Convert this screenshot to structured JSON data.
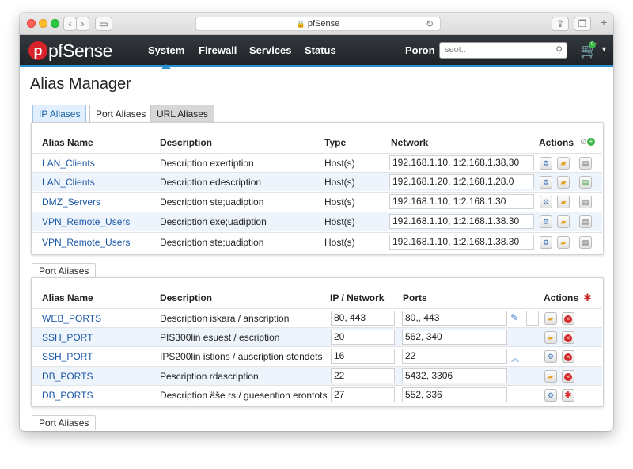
{
  "browser": {
    "url": "pfSense"
  },
  "navbar": {
    "logo_letter": "p",
    "logo_text": "pfSense",
    "items": [
      {
        "label": "System",
        "active": true
      },
      {
        "label": "Firewall"
      },
      {
        "label": "Services"
      },
      {
        "label": "Status"
      },
      {
        "label": "Poron"
      }
    ],
    "search_placeholder": "seot..",
    "cart_badge": "0"
  },
  "page": {
    "title": "Alias Manager"
  },
  "tabs": [
    {
      "label": "IP Aliases",
      "active": true
    },
    {
      "label": "Port Aliases"
    },
    {
      "label": "URL Aliases"
    }
  ],
  "ip_table": {
    "headers": [
      "Alias Name",
      "Description",
      "Type",
      "Network",
      "Actions"
    ],
    "rows": [
      {
        "name": "LAN_Clients",
        "description": "Description exertiption",
        "type": "Host(s)",
        "network": "192.168.1.10, 1:2.168.1.38,30"
      },
      {
        "name": "LAN_Clients",
        "description": "Description edescription",
        "type": "Host(s)",
        "network": "192.168.1.20, 1:2.168.1.28.0"
      },
      {
        "name": "DMZ_Servers",
        "description": "Description ste;uadiption",
        "type": "Host(s)",
        "network": "192.168.1.10, 1:2.168.1.30"
      },
      {
        "name": "VPN_Remote_Users",
        "description": "Description exe;uadiption",
        "type": "Host(s)",
        "network": "192.168.1.10, 1:2.168.1.38.30"
      },
      {
        "name": "VPN_Remote_Users",
        "description": "Description ste;uadiption",
        "type": "Host(s)",
        "network": "192.168.1.10, 1:2.168.1.38.30"
      }
    ]
  },
  "port_section_label": "Port Aliases",
  "port_table": {
    "headers": [
      "Alias Name",
      "Description",
      "IP / Network",
      "Ports",
      "Actions"
    ],
    "rows": [
      {
        "name": "WEB_PORTS",
        "description": "Description iskara / anscription",
        "ip": "80, 443",
        "ports": "80,, 443"
      },
      {
        "name": "SSH_PORT",
        "description": "PIS300lin esuest / escription",
        "ip": "20",
        "ports": "562, 340"
      },
      {
        "name": "SSH_PORT",
        "description": "IPS200lin istions / auscription stendets",
        "ip": "16",
        "ports": "22"
      },
      {
        "name": "DB_PORTS",
        "description": "Pescription rdascription",
        "ip": "22",
        "ports": "5432, 3306"
      },
      {
        "name": "DB_PORTS",
        "description": "Description äše rs / guesention erontots",
        "ip": "27",
        "ports": "552, 336"
      }
    ]
  },
  "footer_section_label": "Port Aliases",
  "colors": {
    "accent": "#2a8fcd",
    "brand_red": "#d8232a",
    "link": "#1a56a6"
  }
}
